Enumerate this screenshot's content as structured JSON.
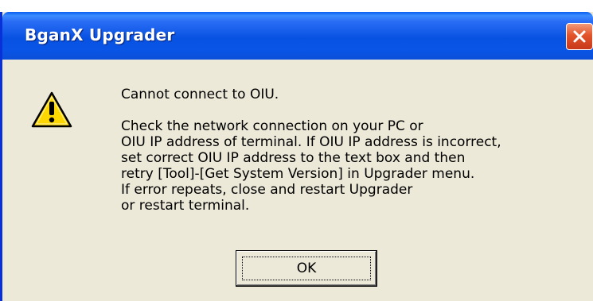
{
  "window": {
    "title": "BganX Upgrader",
    "close_icon": "close-icon"
  },
  "dialog": {
    "icon": "warning-icon",
    "heading": "Cannot connect to OIU.",
    "body_lines": [
      "Check the network connection on your PC or",
      "OIU IP address of terminal. If OIU IP address is incorrect,",
      "set correct OIU IP address to the text box and then",
      "retry [Tool]-[Get System Version] in Upgrader menu.",
      "If error repeats, close and restart Upgrader",
      "or restart terminal."
    ],
    "ok_label": "OK"
  },
  "colors": {
    "titlebar": "#0852e2",
    "face": "#ece9d8",
    "close": "#e2542a",
    "warning_yellow": "#ffd700"
  }
}
